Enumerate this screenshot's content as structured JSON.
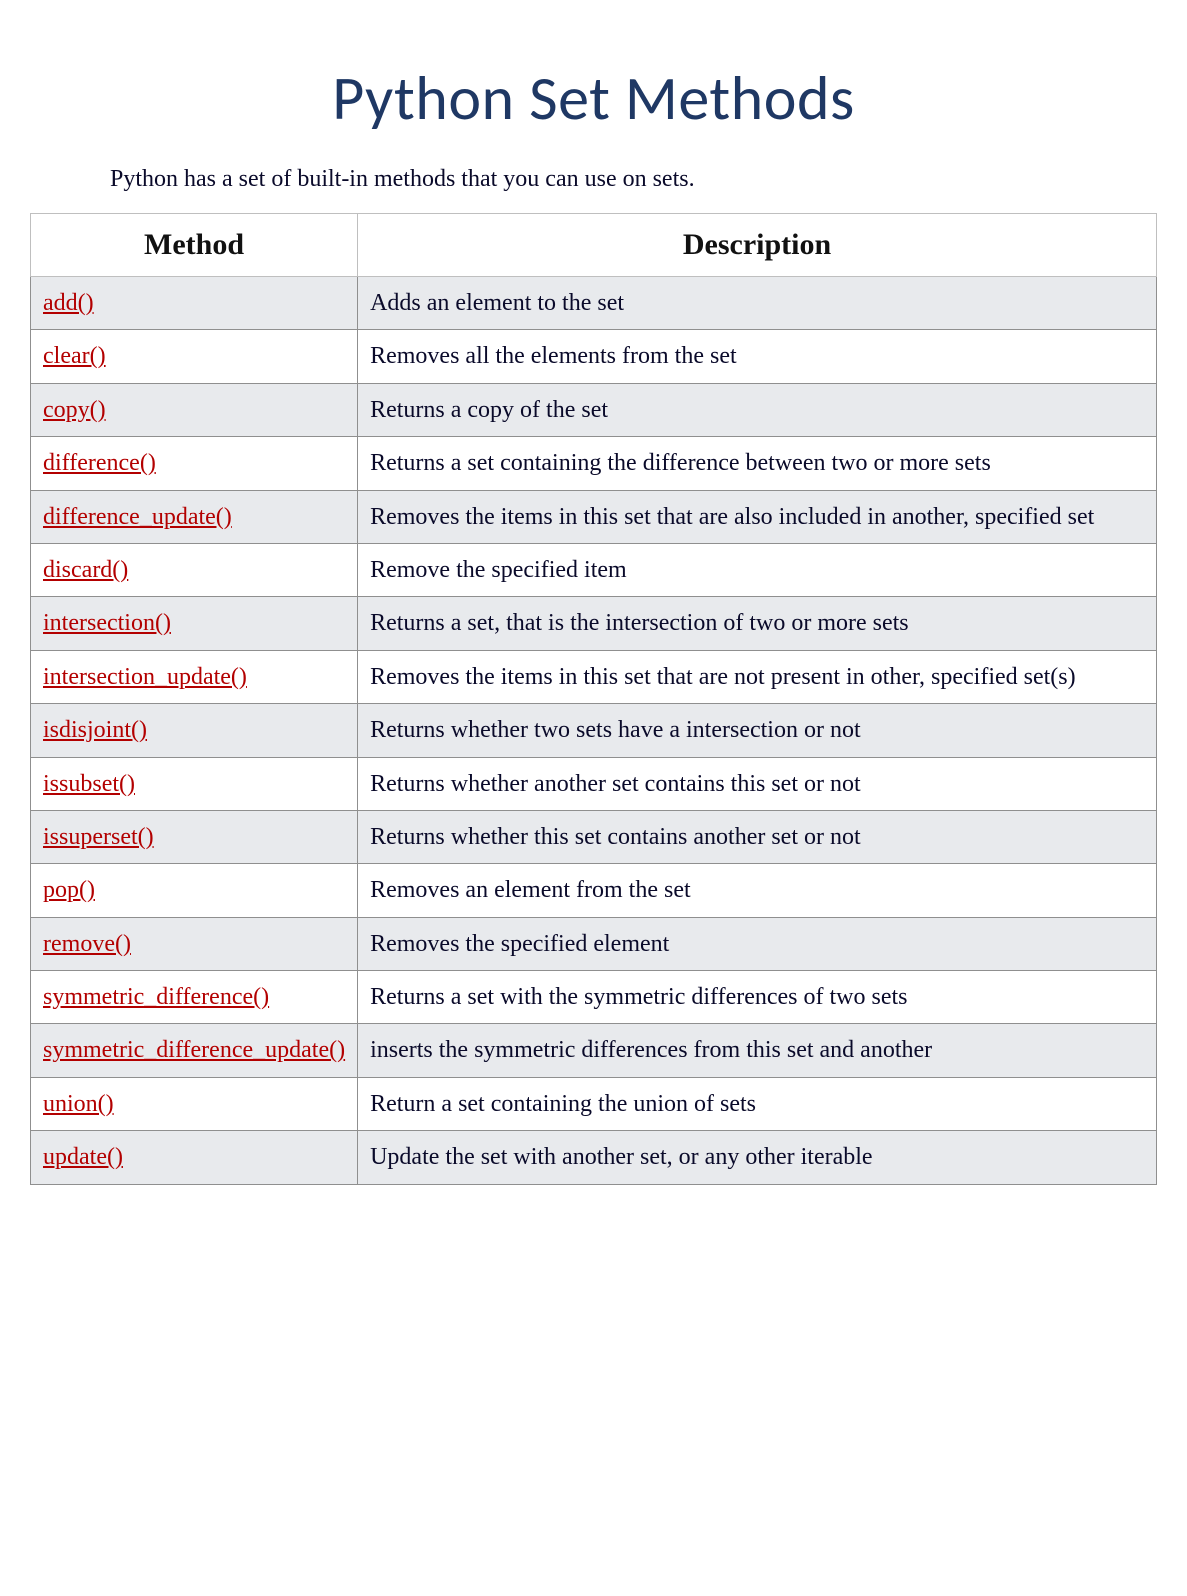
{
  "title": "Python Set Methods",
  "intro": "Python has a set of built-in methods that you can use on sets.",
  "headers": {
    "method": "Method",
    "description": "Description"
  },
  "rows": [
    {
      "method": "add()",
      "description": "Adds an element to the set"
    },
    {
      "method": "clear()",
      "description": "Removes all the elements from the set"
    },
    {
      "method": "copy()",
      "description": "Returns a copy of the set"
    },
    {
      "method": "difference()",
      "description": "Returns a set containing the difference between two or more sets"
    },
    {
      "method": "difference_update()",
      "description": "Removes the items in this set that are also included in another, specified set"
    },
    {
      "method": "discard()",
      "description": "Remove the specified item"
    },
    {
      "method": "intersection()",
      "description": "Returns a set, that is the intersection of two or more sets"
    },
    {
      "method": "intersection_update()",
      "description": "Removes the items in this set that are not present in other, specified set(s)"
    },
    {
      "method": "isdisjoint()",
      "description": "Returns whether two sets have a intersection or not"
    },
    {
      "method": "issubset()",
      "description": "Returns whether another set contains this set or not"
    },
    {
      "method": "issuperset()",
      "description": "Returns whether this set contains another set or not"
    },
    {
      "method": "pop()",
      "description": "Removes an element from the set"
    },
    {
      "method": "remove()",
      "description": "Removes the specified element"
    },
    {
      "method": "symmetric_difference()",
      "description": "Returns a set with the symmetric differences of two sets"
    },
    {
      "method": "symmetric_difference_update()",
      "description": "inserts the symmetric differences from this set and another"
    },
    {
      "method": "union()",
      "description": "Return a set containing the union of sets"
    },
    {
      "method": "update()",
      "description": "Update the set with another set, or any other iterable"
    }
  ]
}
